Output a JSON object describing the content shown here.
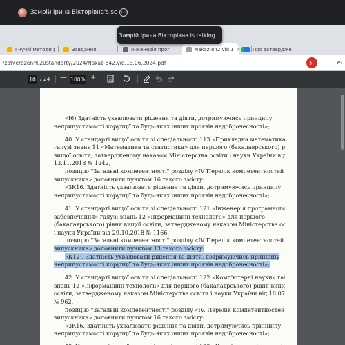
{
  "share_bar": {
    "title": "Замрій Ірина Вікторівна's screer",
    "toast": "Замрій Ірина Вікторівна is talking..."
  },
  "tabs": [
    {
      "label": "Гнучкі методи р",
      "fav_color": "#f9ab00"
    },
    {
      "label": "Завдання",
      "fav_color": "#f9ab00"
    },
    {
      "label": "Інженерія прог",
      "fav_color": "#5f6368"
    },
    {
      "label": "Nakaz-842.vid.1",
      "fav_color": "#9aa0a6",
      "active": true
    },
    {
      "label": "",
      "fav_color": "#34a853"
    },
    {
      "label": "Про затвердже",
      "fav_color": "#1a73e8"
    }
  ],
  "address_bar": {
    "url": "/zatverdzeni%20standarty/2024/Nakaz-842.vid.13.06.2024.pdf",
    "profile_initial": "Я",
    "profile_label": "Уч"
  },
  "pdf_toolbar": {
    "page_current": "10",
    "page_total": "/ 24",
    "zoom_out": "—",
    "zoom": "100%",
    "zoom_in": "+"
  },
  "document": {
    "paragraphs": [
      {
        "lines": [
          {
            "text": "«І6) Здатність ухвалювати рішення та діяти, дотримуючись принципу",
            "indent": true
          },
          {
            "text": "неприпустимості корупції та будь-яких інших проявів недоброчесності»;"
          }
        ]
      },
      {
        "lines": [
          {
            "text": "40. У стандарті вищої освіти зі спеціальності 113 «Прикладна математика»",
            "indent": true
          },
          {
            "text": "галузі знань 11 «Математика та статистика» для першого (бакалаврського) рівня"
          },
          {
            "text": "вищої освіти, затвердженому наказом Міністерства освіти і науки України від"
          },
          {
            "text": "13.11.2018 № 1242,"
          },
          {
            "text": "позицію \"Загальні компетентності\" розділу «ІV Перелік компетентностей",
            "indent": true
          },
          {
            "text": "випускника» доповнити пунктом 16 такого змісту:"
          },
          {
            "text": "«ЗК16. Здатність ухвалювати рішення та діяти, дотримуючись принципу",
            "indent": true
          },
          {
            "text": "неприпустимості корупції та будь-яких інших проявів недоброчесності»;"
          }
        ]
      },
      {
        "lines": [
          {
            "text": "41. У стандарті вищої освіти зі спеціальності 121 «Інженерія програмного",
            "indent": true
          },
          {
            "text": "забезпечення» галузі знань 12 «Інформаційні технології» для першого"
          },
          {
            "text": "(бакалаврського) рівня вищої освіти, затвердженому наказом Міністерства освіти"
          },
          {
            "text": "і науки України від 29.10.2018 № 1166,"
          },
          {
            "text": "позицію \"Загальні компетентності\" розділу «ІV Перелік компетентностей",
            "indent": true
          },
          {
            "text": "випускника» доповнити пунктом 13 такого змісту:",
            "highlight": true
          },
          {
            "text": "«К12¹. Здатність ухвалювати рішення та діяти, дотримуючись принципу",
            "indent": true,
            "highlight": true
          },
          {
            "text": "неприпустимості корупції та будь-яких інших проявів недоброчесності»;",
            "highlight": true
          }
        ]
      },
      {
        "lines": [
          {
            "text": "42. У стандарті вищої освіти зі спеціальності 122 «Комп'ютерні науки» галузі",
            "indent": true
          },
          {
            "text": "знань 12 «Інформаційні технології» для першого (бакалаврського) рівня вищої"
          },
          {
            "text": "освіти, затвердженому наказом Міністерства освіти і науки України від 10.07.2019"
          },
          {
            "text": "№ 962,"
          },
          {
            "text": "позицію \"Загальні компетентності\" розділу «ІV. Перелік компетентностей",
            "indent": true
          },
          {
            "text": "випускника» доповнити пунктом 16 такого змісту:"
          },
          {
            "text": "«ЗК16. Здатність ухвалювати рішення та діяти, дотримуючись принципу",
            "indent": true
          },
          {
            "text": "неприпустимості корупції та будь-яких інших проявів недоброчесності»;"
          }
        ]
      },
      {
        "lines": [
          {
            "text": "43. У стандарті вищої освіти зі спеціальності 123 «Комп'ютерна інженерія»",
            "indent": true
          }
        ]
      }
    ]
  }
}
